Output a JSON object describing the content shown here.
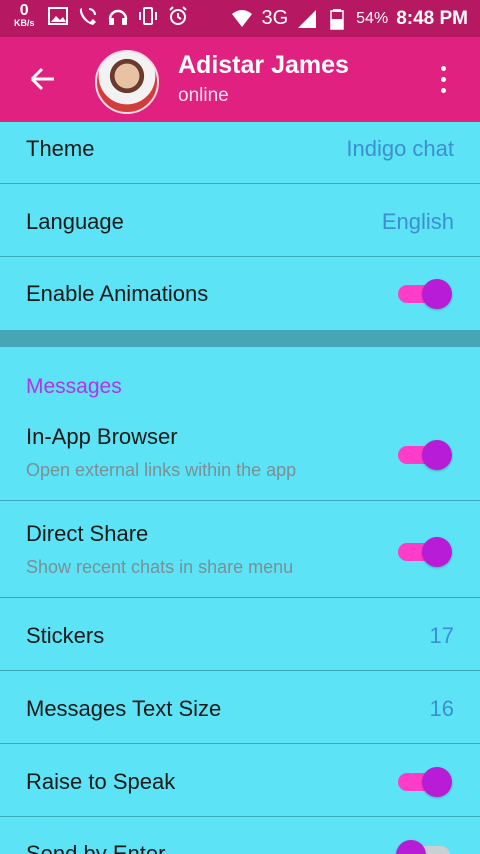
{
  "status_bar": {
    "speed_value": "0",
    "speed_unit": "KB/s",
    "network": "3G",
    "battery": "54%",
    "time": "8:48 PM"
  },
  "header": {
    "name": "Adistar James",
    "status": "online"
  },
  "settings": {
    "theme": {
      "label": "Theme",
      "value": "Indigo chat"
    },
    "language": {
      "label": "Language",
      "value": "English"
    },
    "enable_animations": {
      "label": "Enable Animations",
      "on": true
    },
    "messages_section": "Messages",
    "in_app_browser": {
      "label": "In-App Browser",
      "subtitle": "Open external links within the app",
      "on": true
    },
    "direct_share": {
      "label": "Direct Share",
      "subtitle": "Show recent chats in share menu",
      "on": true
    },
    "stickers": {
      "label": "Stickers",
      "value": "17"
    },
    "text_size": {
      "label": "Messages Text Size",
      "value": "16"
    },
    "raise_to_speak": {
      "label": "Raise to Speak",
      "on": true
    },
    "send_by_enter": {
      "label": "Send by Enter",
      "on": false
    }
  },
  "colors": {
    "status_bar": "#b61862",
    "app_bar": "#e0217f",
    "background": "#5ce3f5",
    "accent_text": "#3d8fd0",
    "section_title": "#b234e6",
    "toggle_track": "#ff3dc9",
    "toggle_thumb": "#b81cd6"
  }
}
